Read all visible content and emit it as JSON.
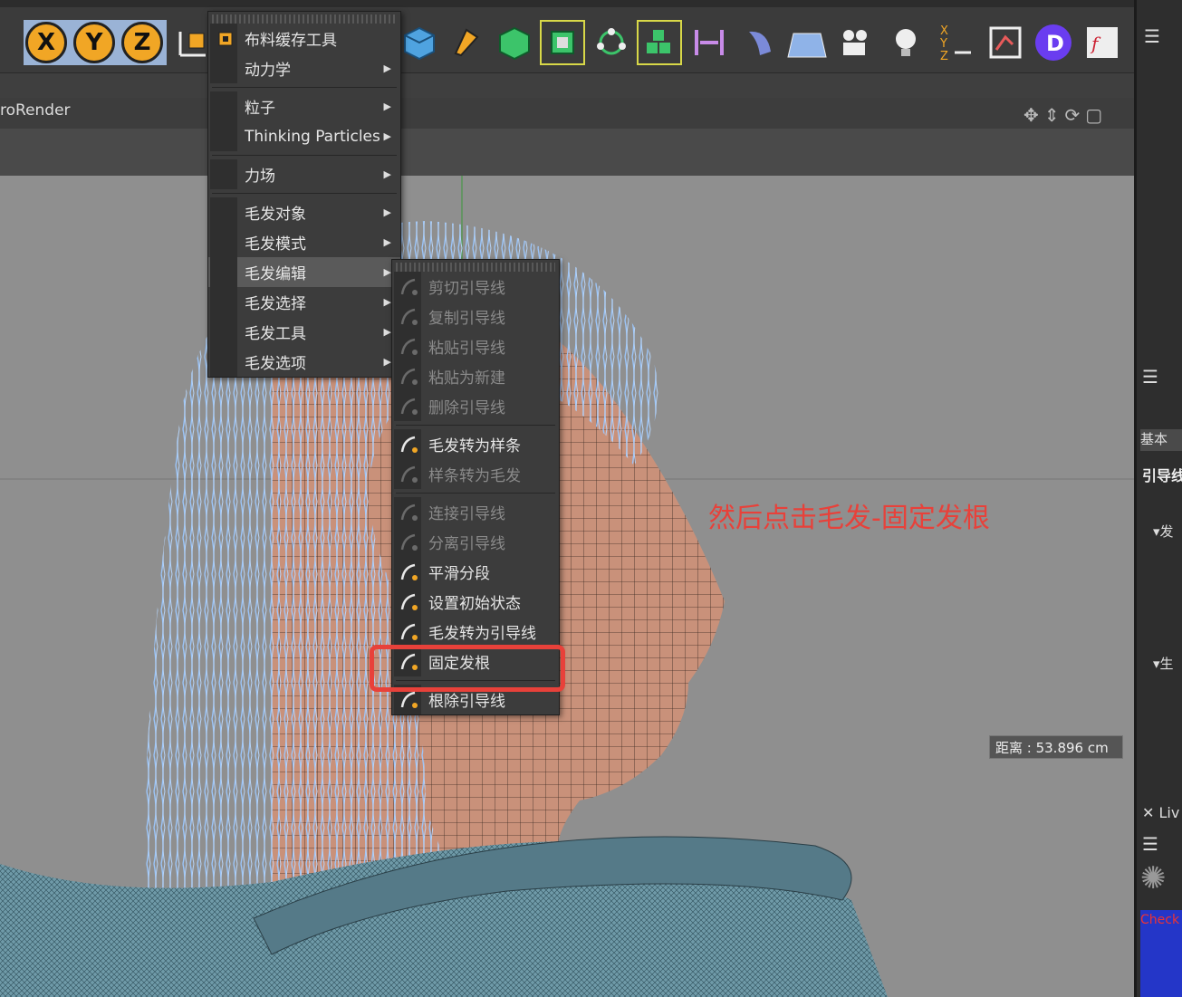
{
  "viewport": {
    "title": "roRender",
    "distance": "距离 : 53.896 cm"
  },
  "main_menu": {
    "items": [
      {
        "label": "布料缓存工具",
        "arrow": false
      },
      {
        "label": "动力学",
        "arrow": true
      },
      {
        "label": "粒子",
        "arrow": true
      },
      {
        "label": "Thinking Particles",
        "arrow": true
      },
      {
        "label": "力场",
        "arrow": true
      },
      {
        "label": "毛发对象",
        "arrow": true
      },
      {
        "label": "毛发模式",
        "arrow": true
      },
      {
        "label": "毛发编辑",
        "arrow": true,
        "highlighted": true
      },
      {
        "label": "毛发选择",
        "arrow": true
      },
      {
        "label": "毛发工具",
        "arrow": true
      },
      {
        "label": "毛发选项",
        "arrow": true
      }
    ]
  },
  "sub_menu": {
    "items": [
      {
        "label": "剪切引导线",
        "disabled": true
      },
      {
        "label": "复制引导线",
        "disabled": true
      },
      {
        "label": "粘贴引导线",
        "disabled": true
      },
      {
        "label": "粘贴为新建",
        "disabled": true
      },
      {
        "label": "删除引导线",
        "disabled": true
      },
      {
        "label": "毛发转为样条",
        "disabled": false
      },
      {
        "label": "样条转为毛发",
        "disabled": true
      },
      {
        "label": "连接引导线",
        "disabled": true
      },
      {
        "label": "分离引导线",
        "disabled": true
      },
      {
        "label": "平滑分段",
        "disabled": false
      },
      {
        "label": "设置初始状态",
        "disabled": false
      },
      {
        "label": "毛发转为引导线",
        "disabled": false
      },
      {
        "label": "固定发根",
        "disabled": false
      },
      {
        "label": "根除引导线",
        "disabled": false
      }
    ]
  },
  "annotation": "然后点击毛发-固定发根",
  "right_panel": {
    "tab_basic": "基本",
    "guides": "引导线",
    "section1": "▾发",
    "section2": "▾生",
    "live": "Liv",
    "check": "Check"
  },
  "colors": {
    "annotation_red": "#e8413a",
    "menu_bg": "#3c3c3c",
    "highlight": "#5a5a5a",
    "hair_blue": "#9cc8ff",
    "axis_orange": "#f1a625"
  }
}
